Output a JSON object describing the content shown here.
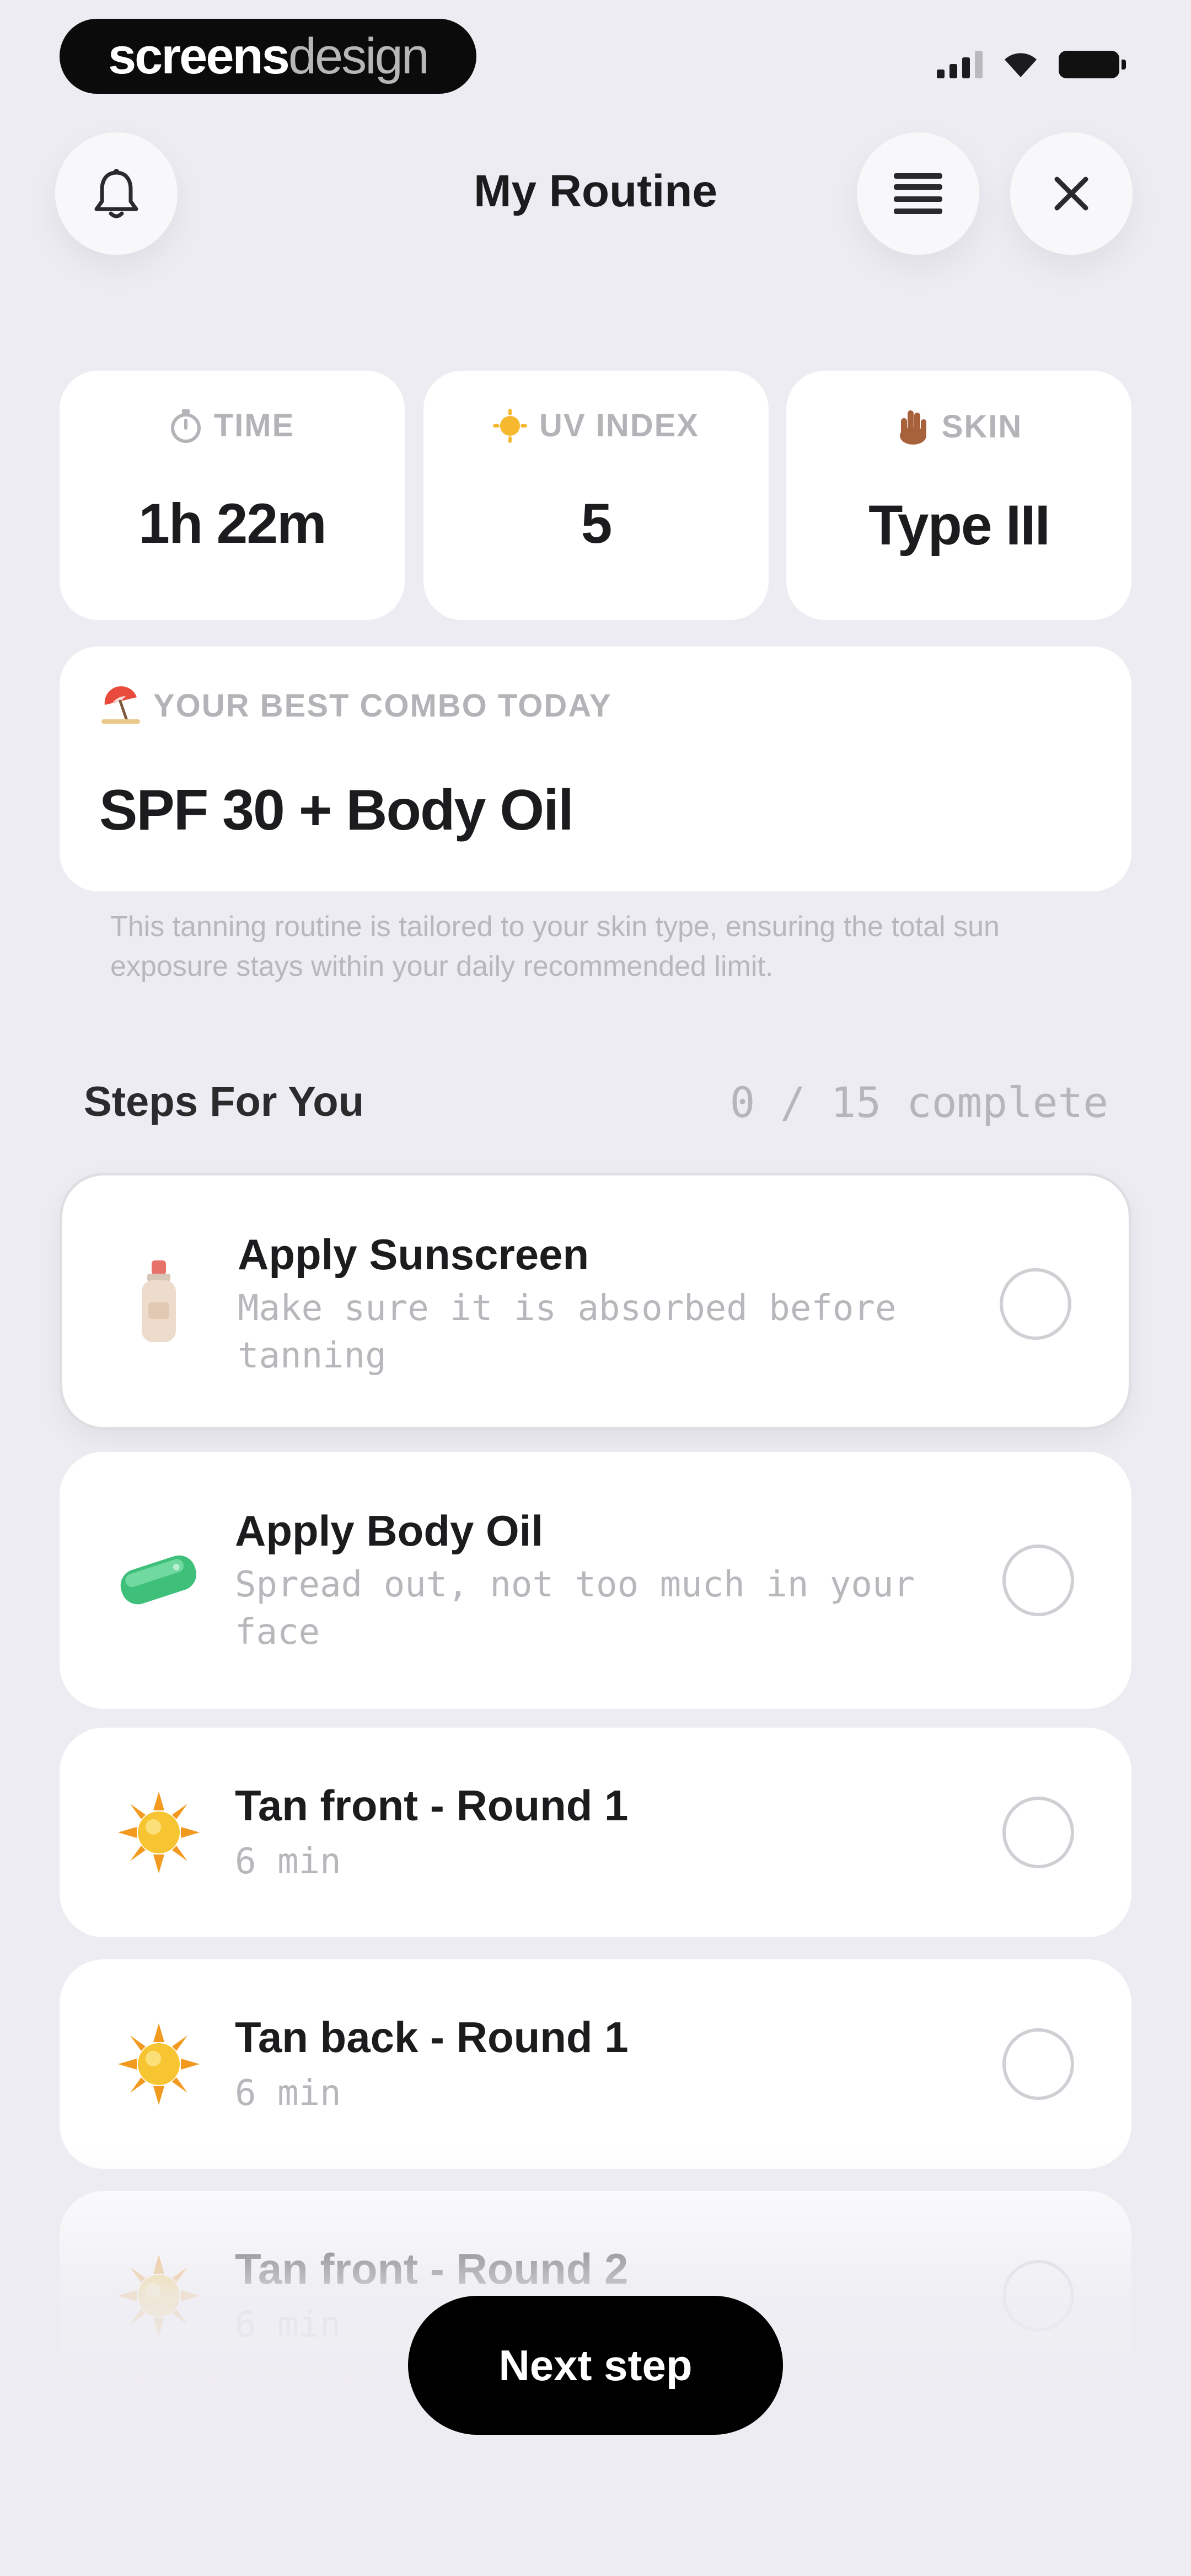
{
  "status_bar": {
    "logo_part1": "screens",
    "logo_part2": "design"
  },
  "header": {
    "title": "My Routine",
    "bell_icon": "bell-icon",
    "menu_icon": "list-icon",
    "close_icon": "close-icon"
  },
  "stats": [
    {
      "icon": "timer-icon",
      "label": "TIME",
      "value": "1h 22m"
    },
    {
      "icon": "sun-icon",
      "label": "UV INDEX",
      "value": "5"
    },
    {
      "icon": "hand-icon",
      "label": "SKIN",
      "value": "Type III"
    }
  ],
  "combo": {
    "icon": "beach-umbrella-icon",
    "label": "YOUR BEST COMBO TODAY",
    "value": "SPF 30 + Body Oil",
    "description": "This tanning routine is tailored to your skin type, ensuring the total sun exposure stays within your daily recommended limit."
  },
  "steps_section": {
    "title": "Steps For You",
    "count": "0 / 15 complete"
  },
  "steps": [
    {
      "icon": "sunscreen-bottle-icon",
      "title": "Apply Sunscreen",
      "subtitle": "Make sure it is absorbed before tanning"
    },
    {
      "icon": "soap-icon",
      "title": "Apply Body Oil",
      "subtitle": "Spread out, not too much in your face"
    },
    {
      "icon": "sun-icon",
      "title": "Tan front - Round 1",
      "subtitle": "6 min"
    },
    {
      "icon": "sun-icon",
      "title": "Tan back - Round 1",
      "subtitle": "6 min"
    },
    {
      "icon": "sun-icon",
      "title": "Tan front - Round 2",
      "subtitle": "6 min"
    }
  ],
  "next_button": {
    "label": "Next step"
  },
  "colors": {
    "background": "#edecf2",
    "card": "#ffffff",
    "primary_button": "#000000",
    "muted_text": "#b7b7bc"
  }
}
